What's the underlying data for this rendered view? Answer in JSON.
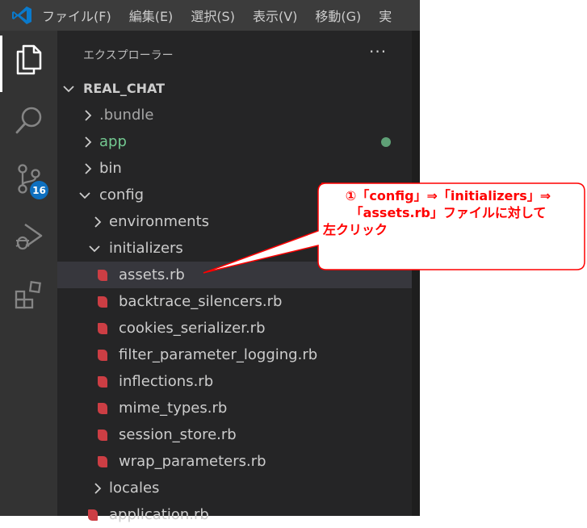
{
  "menubar": {
    "items": [
      "ファイル(F)",
      "編集(E)",
      "選択(S)",
      "表示(V)",
      "移動(G)",
      "実"
    ]
  },
  "activitybar": {
    "items": [
      {
        "name": "explorer",
        "icon": "files-icon",
        "active": true
      },
      {
        "name": "search",
        "icon": "search-icon"
      },
      {
        "name": "source-control",
        "icon": "source-control-icon",
        "badge": "16"
      },
      {
        "name": "run-debug",
        "icon": "run-debug-icon"
      },
      {
        "name": "extensions",
        "icon": "extensions-icon"
      }
    ]
  },
  "sidebar": {
    "title": "エクスプローラー",
    "more": "···",
    "root": "REAL_CHAT",
    "tree": [
      {
        "label": ".bundle",
        "type": "folder",
        "expanded": false
      },
      {
        "label": "app",
        "type": "folder",
        "expanded": false,
        "modified": true
      },
      {
        "label": "bin",
        "type": "folder",
        "expanded": false
      },
      {
        "label": "config",
        "type": "folder",
        "expanded": true
      },
      {
        "label": "environments",
        "type": "folder",
        "expanded": false
      },
      {
        "label": "initializers",
        "type": "folder",
        "expanded": true
      },
      {
        "label": "assets.rb",
        "type": "ruby-file",
        "selected": true
      },
      {
        "label": "backtrace_silencers.rb",
        "type": "ruby-file"
      },
      {
        "label": "cookies_serializer.rb",
        "type": "ruby-file"
      },
      {
        "label": "filter_parameter_logging.rb",
        "type": "ruby-file"
      },
      {
        "label": "inflections.rb",
        "type": "ruby-file"
      },
      {
        "label": "mime_types.rb",
        "type": "ruby-file"
      },
      {
        "label": "session_store.rb",
        "type": "ruby-file"
      },
      {
        "label": "wrap_parameters.rb",
        "type": "ruby-file"
      },
      {
        "label": "locales",
        "type": "folder",
        "expanded": false
      },
      {
        "label": "application.rb",
        "type": "ruby-file"
      }
    ]
  },
  "callout": {
    "line1": "①「config」⇒「initializers」⇒",
    "line2": "「assets.rb」ファイルに対して",
    "line3": "左クリック"
  },
  "colors": {
    "titlebar": "#3c3c3c",
    "activitybar": "#333333",
    "sidebar": "#252526",
    "selection": "#37373d",
    "modified_green": "#73c991",
    "ruby_red": "#cc3e44",
    "badge_blue": "#0e70c0",
    "callout_red": "#ff0000"
  }
}
